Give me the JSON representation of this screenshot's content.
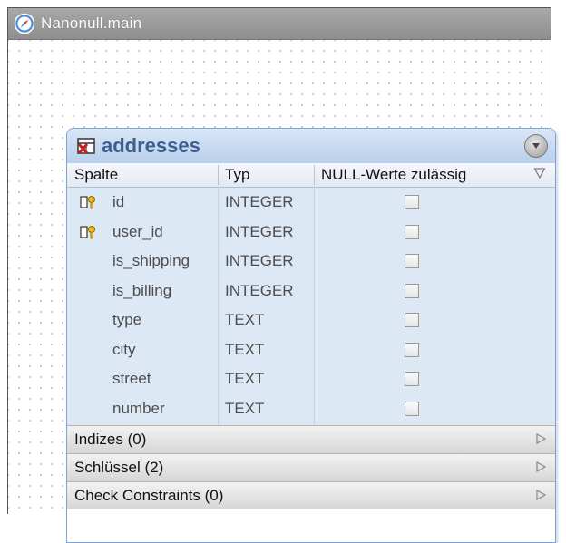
{
  "window": {
    "title": "Nanonull.main"
  },
  "table": {
    "name": "addresses",
    "columns_header": {
      "spalte": "Spalte",
      "typ": "Typ",
      "null": "NULL-Werte zulässig"
    },
    "rows": [
      {
        "name": "id",
        "type": "INTEGER",
        "key": true,
        "nullable": false
      },
      {
        "name": "user_id",
        "type": "INTEGER",
        "key": true,
        "nullable": false
      },
      {
        "name": "is_shipping",
        "type": "INTEGER",
        "key": false,
        "nullable": false
      },
      {
        "name": "is_billing",
        "type": "INTEGER",
        "key": false,
        "nullable": false
      },
      {
        "name": "type",
        "type": "TEXT",
        "key": false,
        "nullable": false
      },
      {
        "name": "city",
        "type": "TEXT",
        "key": false,
        "nullable": false
      },
      {
        "name": "street",
        "type": "TEXT",
        "key": false,
        "nullable": false
      },
      {
        "name": "number",
        "type": "TEXT",
        "key": false,
        "nullable": false
      }
    ],
    "sections": [
      {
        "label": "Indizes (0)"
      },
      {
        "label": "Schlüssel (2)"
      },
      {
        "label": "Check Constraints (0)"
      }
    ]
  },
  "icons": {
    "window": "compass-icon",
    "table": "table-delete-icon",
    "collapse": "collapse-button-icon",
    "key": "key-icon",
    "filter": "filter-icon",
    "expand": "expand-arrow-icon"
  },
  "colors": {
    "header_text": "#3d5f90",
    "rows_bg": "#dde8f5",
    "border": "#7fa3d6"
  }
}
